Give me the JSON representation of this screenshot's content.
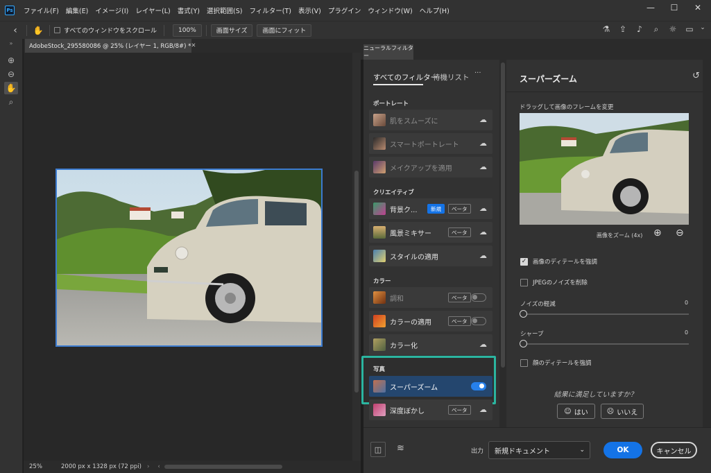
{
  "app": {
    "logo": "Ps"
  },
  "menu": [
    "ファイル(F)",
    "編集(E)",
    "イメージ(I)",
    "レイヤー(L)",
    "書式(Y)",
    "選択範囲(S)",
    "フィルター(T)",
    "表示(V)",
    "プラグイン",
    "ウィンドウ(W)",
    "ヘルプ(H)"
  ],
  "window_controls": {
    "minimize": "—",
    "maximize": "☐",
    "close": "✕"
  },
  "options_bar": {
    "scroll_all_label": "すべてのウィンドウをスクロール",
    "zoom_100": "100%",
    "fit_screen": "画面サイズ",
    "fill_screen": "画面にフィット"
  },
  "document": {
    "tab_title": "AdobeStock_295580086 @ 25% (レイヤー 1, RGB/8#) *",
    "zoom": "25%",
    "info": "2000 px x 1328 px (72 ppi)"
  },
  "neural_filters": {
    "panel_tab": "ニューラルフィルター",
    "tabs": {
      "all": "すべてのフィルター",
      "waitlist": "待機リスト",
      "more": "···"
    },
    "categories": {
      "portrait": "ポートレート",
      "creative": "クリエイティブ",
      "color": "カラー",
      "photo": "写真"
    },
    "filters": {
      "skin_smoothing": "肌をスムーズに",
      "smart_portrait": "スマートポートレート",
      "makeup_transfer": "メイクアップを適用",
      "background": "背景ク...",
      "landscape_mixer": "風景ミキサー",
      "style_transfer": "スタイルの適用",
      "harmonization": "調和",
      "color_transfer": "カラーの適用",
      "colorize": "カラー化",
      "super_zoom": "スーパーズーム",
      "depth_blur": "深度ぼかし"
    },
    "badges": {
      "new": "新規",
      "beta": "ベータ"
    },
    "toggles": {
      "harmonization": false,
      "color_transfer": false,
      "super_zoom": true
    }
  },
  "settings": {
    "title": "スーパーズーム",
    "drag_hint": "ドラッグして画像のフレームを変更",
    "zoom_label": "画像をズーム (4x)",
    "enhance_detail": "画像のディテールを強調",
    "enhance_detail_checked": true,
    "remove_jpeg_noise": "JPEGのノイズを削除",
    "remove_jpeg_noise_checked": false,
    "noise_reduction": "ノイズの軽減",
    "noise_reduction_value": "0",
    "sharpen": "シャープ",
    "sharpen_value": "0",
    "face_detail": "顔のディテールを強調",
    "face_detail_checked": false,
    "feedback_question": "結果に満足していますか？",
    "yes": "はい",
    "no": "いいえ"
  },
  "bottom_bar": {
    "output_label": "出力",
    "output_value": "新規ドキュメント",
    "ok": "OK",
    "cancel": "キャンセル"
  },
  "colors": {
    "accent": "#1473e6",
    "highlight": "#2bb5a0",
    "selected_row": "#24466e"
  }
}
